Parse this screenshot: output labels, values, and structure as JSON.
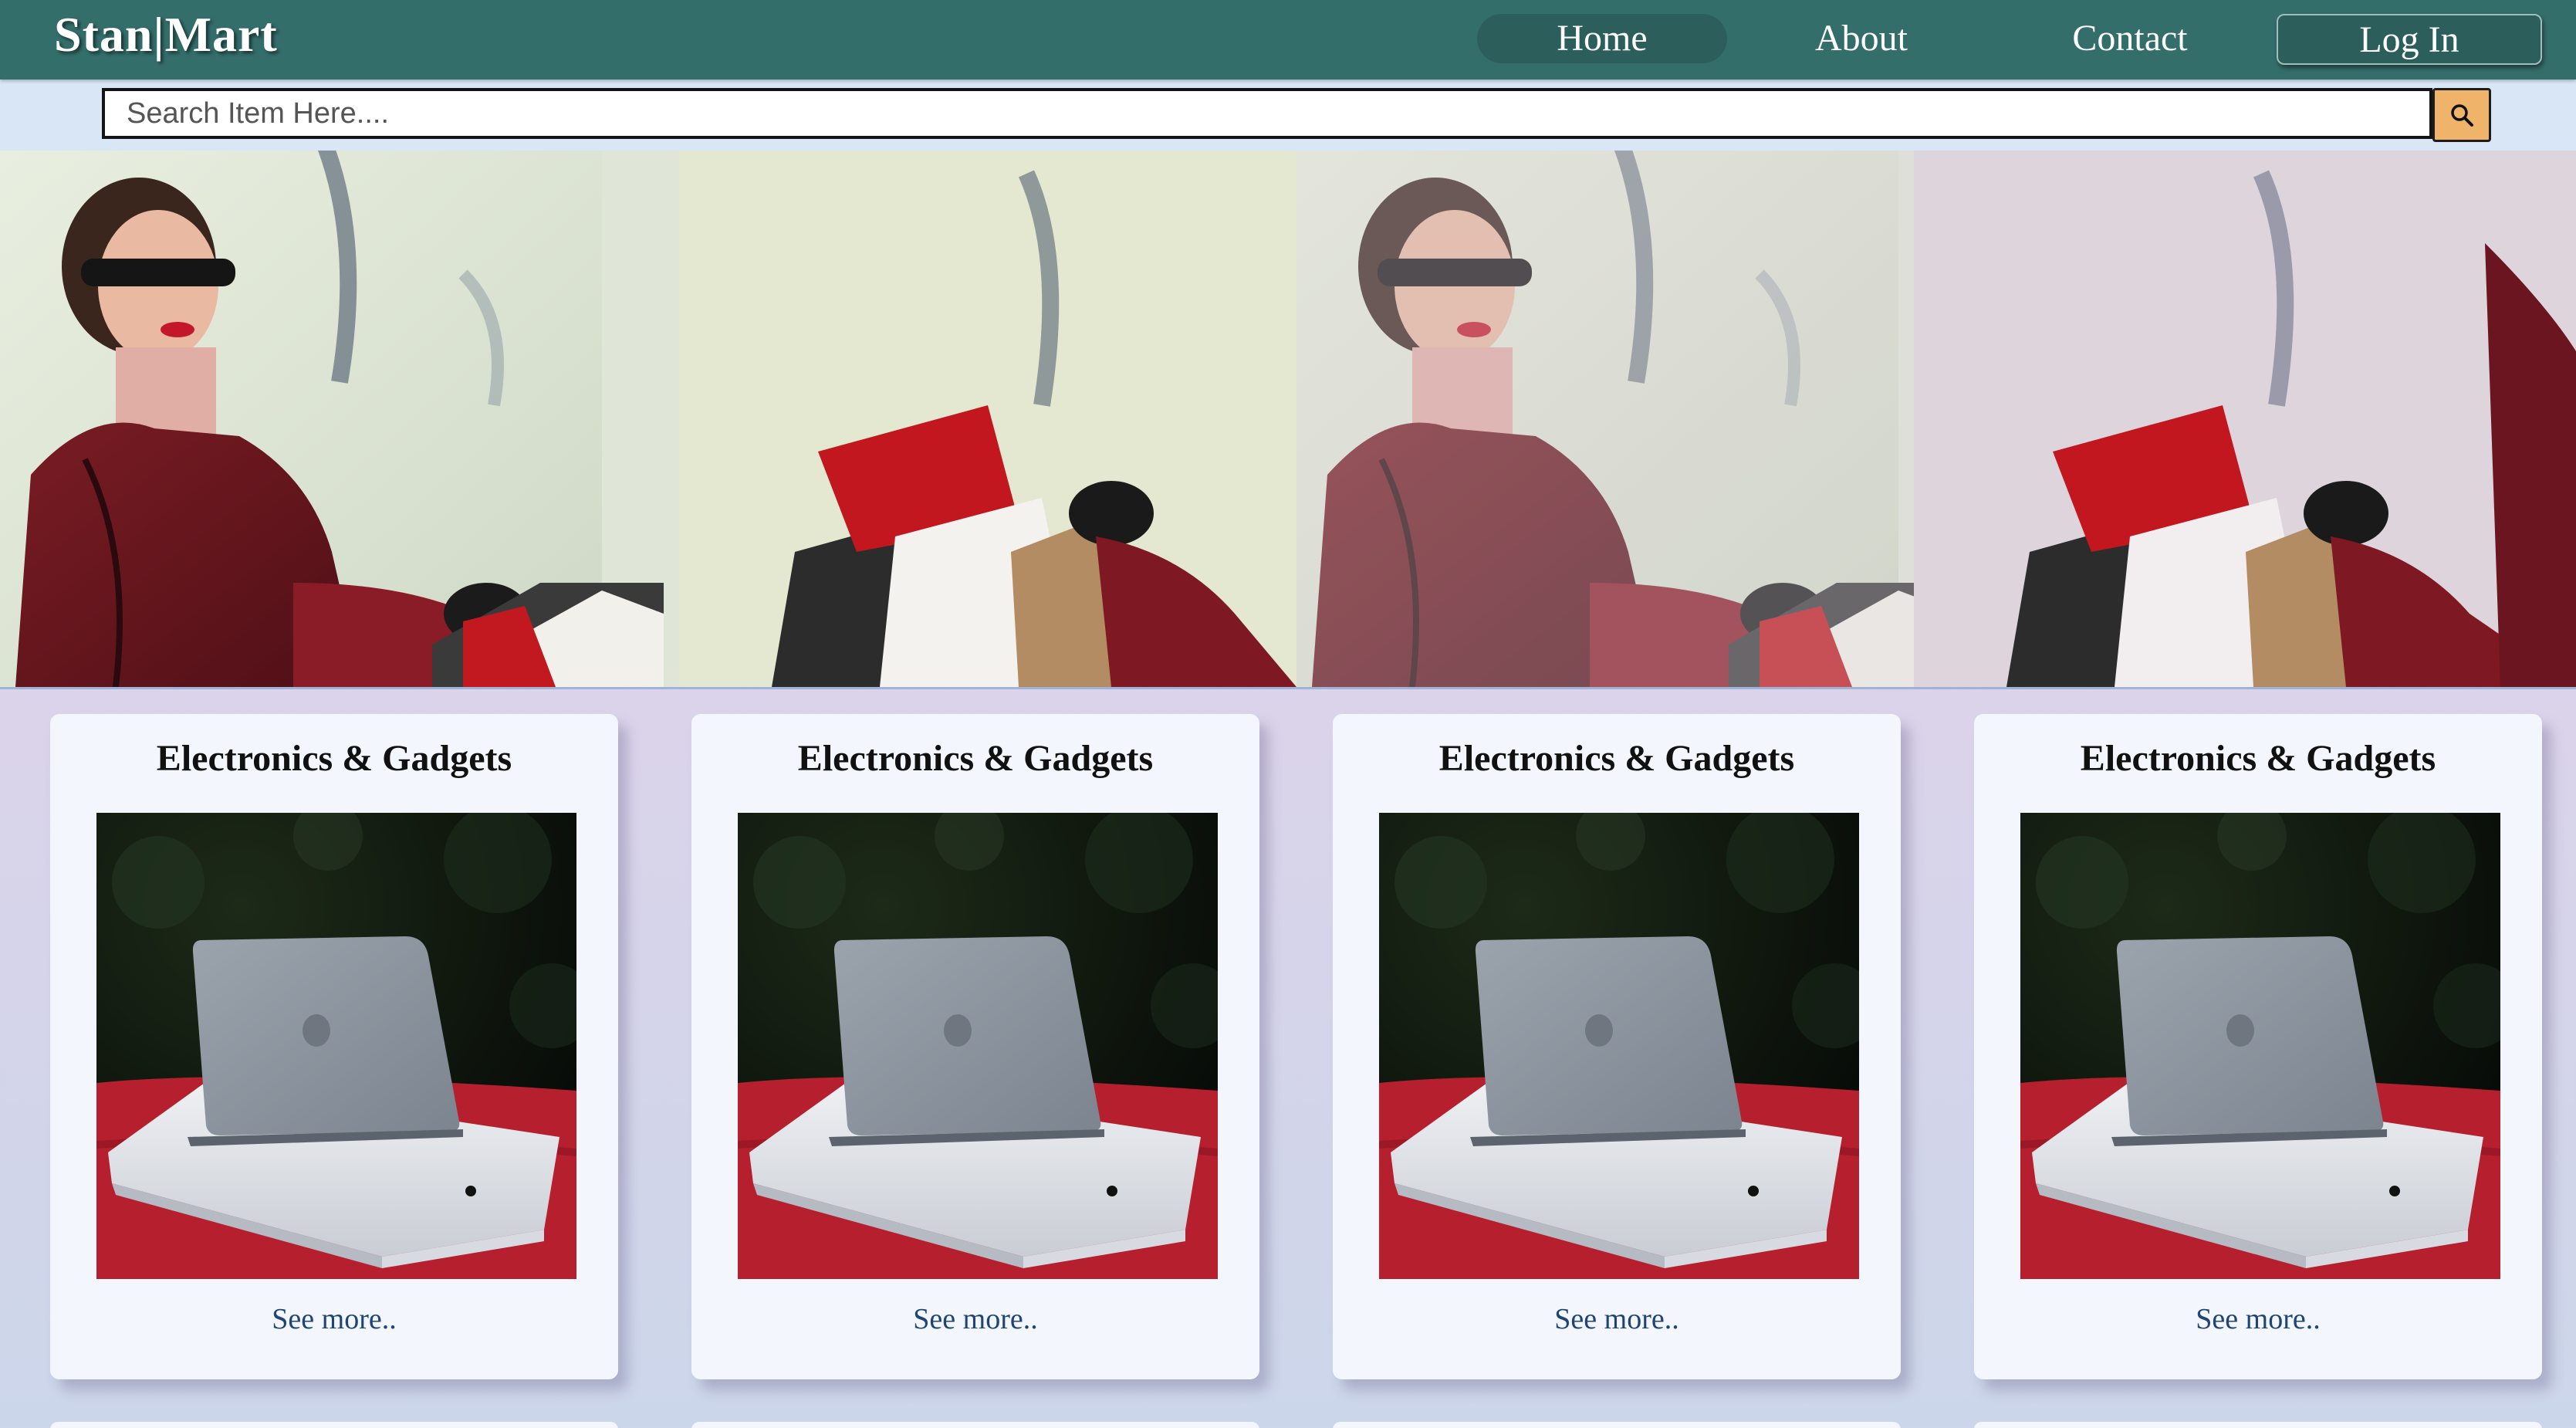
{
  "brand": {
    "logo_text": "Stan|Mart"
  },
  "nav": {
    "home": "Home",
    "about": "About",
    "contact": "Contact",
    "login": "Log In"
  },
  "search": {
    "placeholder": "Search Item Here....",
    "button_icon": "search-icon"
  },
  "colors": {
    "navbar": "#346e6b",
    "nav_active": "#2c5f5c",
    "search_button": "#efb46a",
    "card_bg": "#f3f7fd",
    "link": "#1f4477"
  },
  "hero": {
    "image": "woman-with-shopping-bags-photo",
    "panels": 4
  },
  "categories": [
    {
      "title": "Electronics & Gadgets",
      "image": "laptop-on-box-photo",
      "link_label": "See more.."
    },
    {
      "title": "Electronics & Gadgets",
      "image": "laptop-on-box-photo",
      "link_label": "See more.."
    },
    {
      "title": "Electronics & Gadgets",
      "image": "laptop-on-box-photo",
      "link_label": "See more.."
    },
    {
      "title": "Electronics & Gadgets",
      "image": "laptop-on-box-photo",
      "link_label": "See more.."
    }
  ]
}
